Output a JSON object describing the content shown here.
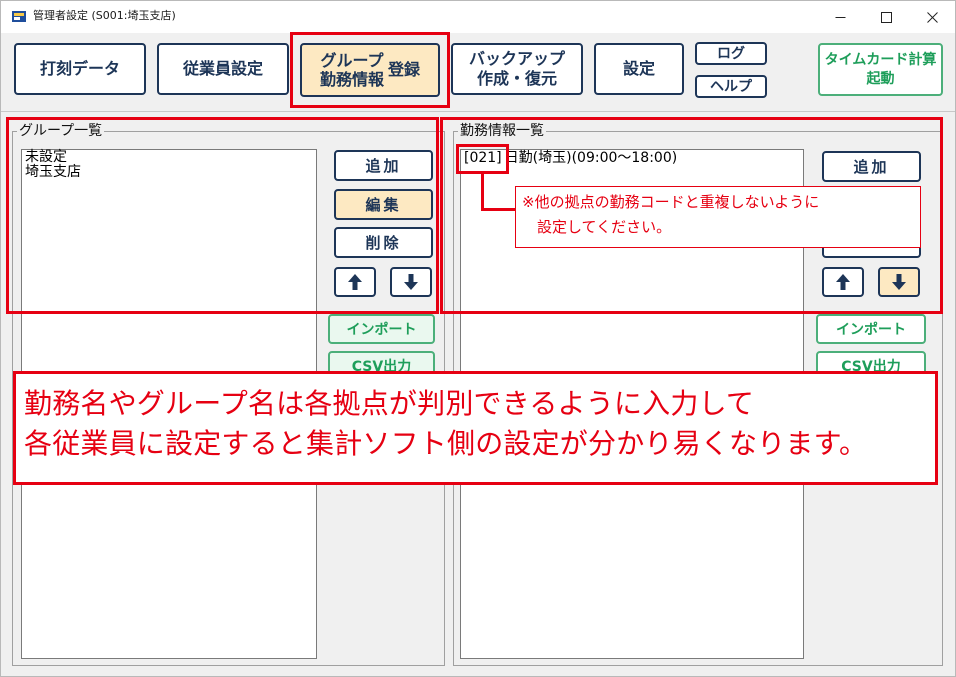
{
  "window": {
    "title": "管理者設定 (S001:埼玉支店)",
    "controls": {
      "minimize": "—",
      "maximize": "☐",
      "close": "✕"
    }
  },
  "toolbar": {
    "stamp_data": "打刻データ",
    "employee_settings": "従業員設定",
    "group_work_register": {
      "line1": "グループ",
      "line2": "勤務情報",
      "side": "登録"
    },
    "backup_restore": {
      "line1": "バックアップ",
      "line2": "作成・復元"
    },
    "settings": "設定",
    "log": "ログ",
    "help": "ヘルプ",
    "timecard_launch": {
      "line1": "タイムカード計算",
      "line2": "起動"
    }
  },
  "group_panel": {
    "title": "グループ一覧",
    "items": [
      "未設定",
      "埼玉支店"
    ],
    "add": "追加",
    "edit": "編集",
    "delete": "削除",
    "import": "インポート",
    "csv_output": "CSV出力"
  },
  "work_panel": {
    "title": "勤務情報一覧",
    "items": [
      {
        "code": "[021]",
        "label": "日勤(埼玉)(09:00～18:00)"
      }
    ],
    "add": "追加",
    "import": "インポート",
    "csv_output": "CSV出力"
  },
  "annotations": {
    "callout": "※他の拠点の勤務コードと重複しないように\n　設定してください。",
    "banner": "勤務名やグループ名は各拠点が判別できるように入力して\n各従業員に設定すると集計ソフト側の設定が分かり易くなります。"
  },
  "colors": {
    "accent_navy": "#1d3557",
    "highlight": "#fde9c2",
    "green": "#1e9e5a",
    "annotation_red": "#e60012"
  }
}
